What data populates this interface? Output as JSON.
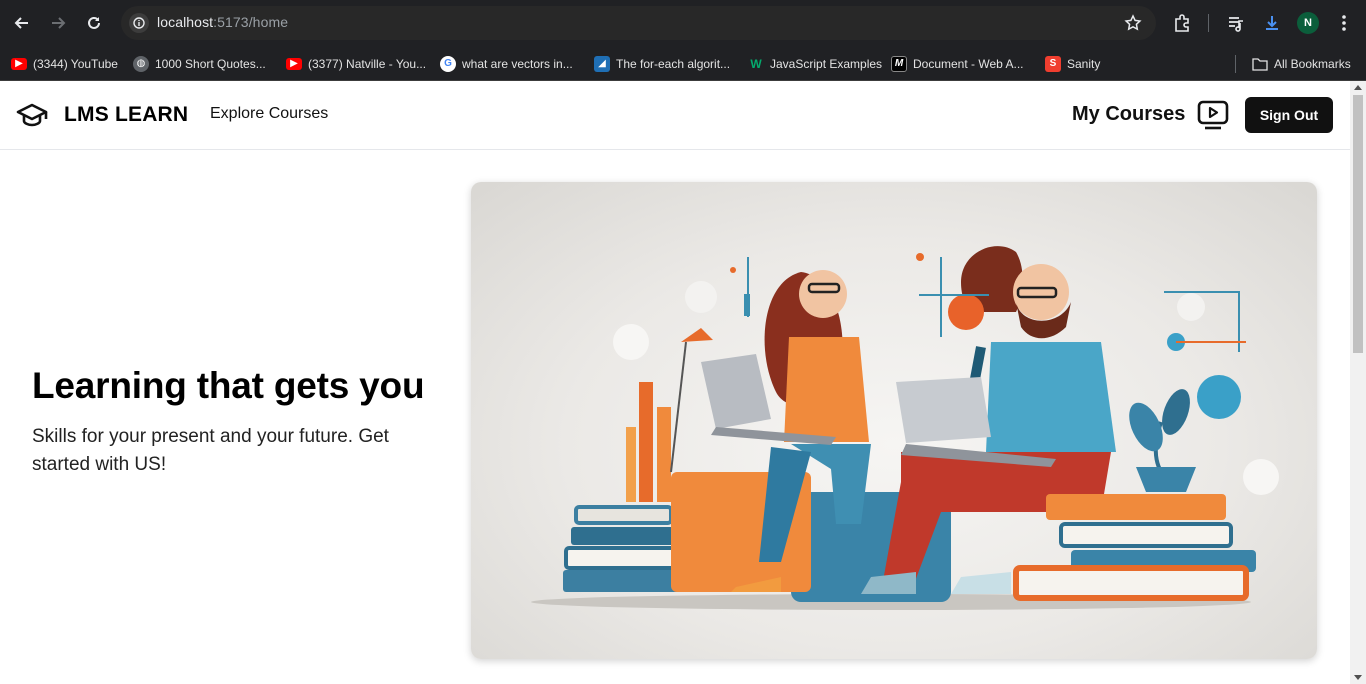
{
  "browser": {
    "url_host": "localhost",
    "url_path": ":5173/home",
    "profile_initial": "N",
    "bookmarks": [
      {
        "label": "(3344) YouTube",
        "icon": "youtube-icon"
      },
      {
        "label": "1000 Short Quotes...",
        "icon": "globe-icon"
      },
      {
        "label": "(3377) Natville - You...",
        "icon": "youtube-icon"
      },
      {
        "label": "what are vectors in...",
        "icon": "google-icon"
      },
      {
        "label": "The for-each algorit...",
        "icon": "site-icon"
      },
      {
        "label": "JavaScript Examples",
        "icon": "w3-icon"
      },
      {
        "label": "Document - Web A...",
        "icon": "mdn-icon"
      },
      {
        "label": "Sanity",
        "icon": "sanity-icon"
      }
    ],
    "all_bookmarks": "All Bookmarks"
  },
  "header": {
    "brand": "LMS LEARN",
    "explore": "Explore Courses",
    "my_courses": "My Courses",
    "sign_out": "Sign Out"
  },
  "hero": {
    "title": "Learning that gets you",
    "subtitle": "Skills for your present and your future. Get started with US!",
    "illustration": "students-with-laptops-illustration"
  },
  "colors": {
    "brand_dark": "#111111",
    "accent_orange": "#f07a2a",
    "accent_teal": "#3a8fb0"
  }
}
